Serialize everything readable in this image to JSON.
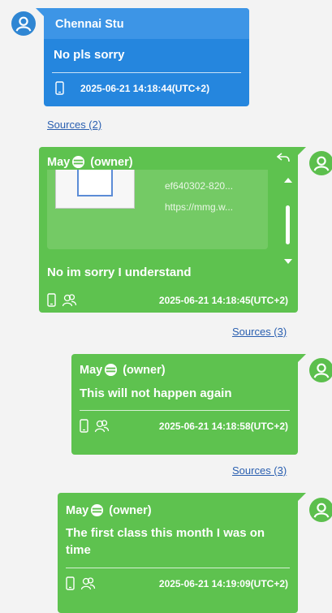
{
  "messages": [
    {
      "sender": "Chennai Stu",
      "text": "No pls sorry",
      "timestamp": "2025-06-21 14:18:44(UTC+2)",
      "sources": "Sources (2)",
      "color": "#2586de"
    },
    {
      "sender": "May",
      "role": "(owner)",
      "attachment_name": "ef640302-820...",
      "attachment_url": "https://mmg.w...",
      "text": "No im sorry  I understand",
      "timestamp": "2025-06-21 14:18:45(UTC+2)",
      "sources": "Sources (3)",
      "color": "#5ec24f"
    },
    {
      "sender": "May",
      "role": "(owner)",
      "text": "This will not happen again",
      "timestamp": "2025-06-21 14:18:58(UTC+2)",
      "sources": "Sources (3)",
      "color": "#5ec24f"
    },
    {
      "sender": "May",
      "role": "(owner)",
      "text": "The first class this month I was on time",
      "timestamp": "2025-06-21 14:19:09(UTC+2)",
      "color": "#5ec24f"
    }
  ],
  "icons": {
    "avatar": "person-icon",
    "device": "phone-icon",
    "contacts": "group-icon",
    "reply": "reply-icon",
    "emoji": "smiley-icon"
  }
}
